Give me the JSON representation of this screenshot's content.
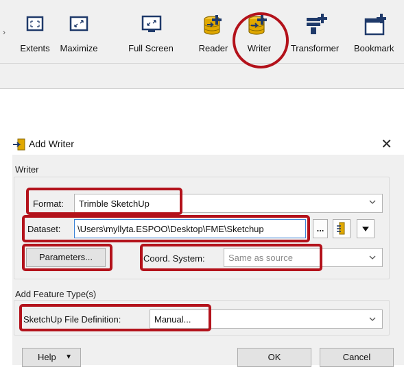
{
  "toolbar": {
    "items": [
      {
        "label": "Extents",
        "icon": "extents-icon"
      },
      {
        "label": "Maximize",
        "icon": "maximize-icon"
      },
      {
        "label": "Full Screen",
        "icon": "full-screen-icon"
      },
      {
        "label": "Reader",
        "icon": "reader-icon"
      },
      {
        "label": "Writer",
        "icon": "writer-icon"
      },
      {
        "label": "Transformer",
        "icon": "transformer-icon"
      },
      {
        "label": "Bookmark",
        "icon": "bookmark-icon"
      }
    ]
  },
  "dialog": {
    "title": "Add Writer",
    "close_glyph": "✕",
    "writer_group": {
      "label": "Writer",
      "format_label": "Format:",
      "format_value": "Trimble SketchUp",
      "dataset_label": "Dataset:",
      "dataset_value": "\\Users\\myllyta.ESPOO\\Desktop\\FME\\Sketchup",
      "browse_label": "...",
      "parameters_label": "Parameters...",
      "coord_label": "Coord. System:",
      "coord_placeholder": "Same as source"
    },
    "feature_group": {
      "label": "Add Feature Type(s)",
      "definition_label": "SketchUp File Definition:",
      "definition_value": "Manual..."
    },
    "buttons": {
      "help": "Help",
      "help_arrow": "▼",
      "ok": "OK",
      "cancel": "Cancel"
    }
  },
  "colors": {
    "annotation": "#b3121b",
    "accent_yellow": "#e0a800",
    "icon_navy": "#1f3a6a",
    "focus_blue": "#3b84d7"
  }
}
